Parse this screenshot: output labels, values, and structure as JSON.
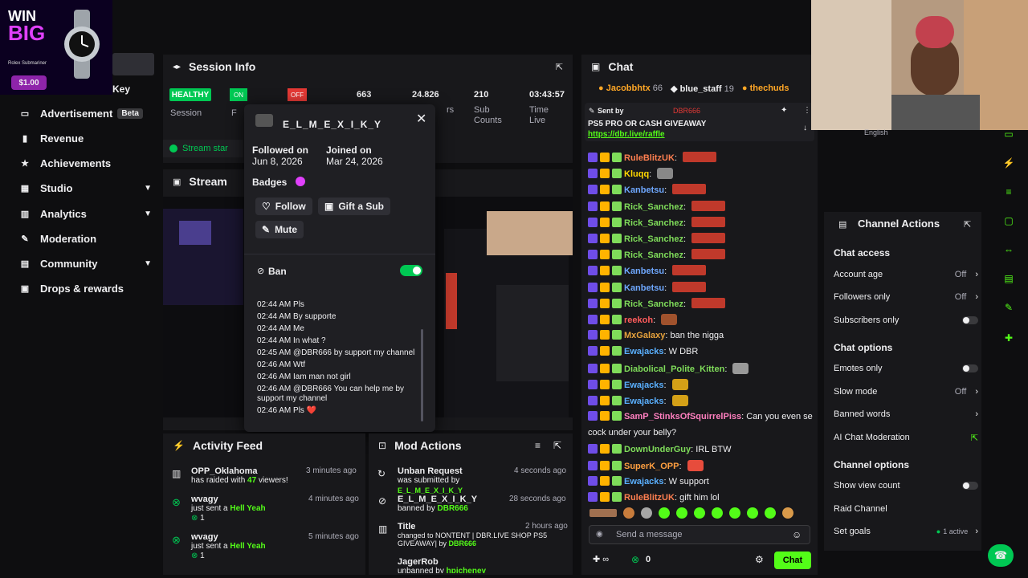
{
  "promo": {
    "line1": "WIN",
    "line2": "BIG",
    "small": "Rolex Submariner",
    "price": "$1.00"
  },
  "nav": {
    "key_label": "Key",
    "items": [
      {
        "label": "Advertisement",
        "badge": "Beta",
        "icon": "ad-icon"
      },
      {
        "label": "Revenue",
        "icon": "dollar-icon"
      },
      {
        "label": "Achievements",
        "icon": "star-icon"
      },
      {
        "label": "Studio",
        "icon": "studio-icon",
        "chevron": true
      },
      {
        "label": "Analytics",
        "icon": "chart-icon",
        "chevron": true
      },
      {
        "label": "Moderation",
        "icon": "wrench-icon"
      },
      {
        "label": "Community",
        "icon": "people-icon",
        "chevron": true
      },
      {
        "label": "Drops & rewards",
        "icon": "gift-icon"
      }
    ]
  },
  "session": {
    "title": "Session Info",
    "health_badge": "HEALTHY",
    "on_badge": "ON",
    "off_badge": "OFF",
    "label_session": "Session",
    "label_f": "F",
    "val_663": "663",
    "val_followers": "24.826",
    "label_followers_partial": "rs",
    "val_subs": "210",
    "label_subs": "Sub Counts",
    "val_time": "03:43:57",
    "label_time": "Time Live",
    "stream_status": "Stream star"
  },
  "stream": {
    "title": "Stream"
  },
  "popup": {
    "username": "E_L_M_E_X_I_K_Y",
    "followed_label": "Followed on",
    "followed_date": "Jun 8, 2026",
    "joined_label": "Joined on",
    "joined_date": "Mar 24, 2026",
    "badges_label": "Badges",
    "follow": "Follow",
    "gift": "Gift a Sub",
    "mute": "Mute",
    "ban": "Ban",
    "log": [
      "02:44 AM Pls",
      "02:44 AM By supporte",
      "02:44 AM Me",
      "02:44 AM In what ?",
      "02:45 AM @DBR666 by support my channel",
      "02:46 AM Wtf",
      "02:46 AM Iam man not girl",
      "02:46 AM @DBR666 You can help me by support my channel",
      "02:46 AM Pls ❤️"
    ]
  },
  "activity": {
    "title": "Activity Feed",
    "items": [
      {
        "name": "OPP_Oklahoma",
        "text1": "has raided with ",
        "bold": "47",
        "text2": " viewers!",
        "time": "3 minutes ago"
      },
      {
        "name": "wvagy",
        "text1": "just sent a ",
        "bold": "Hell Yeah",
        "text2": "",
        "count": "1",
        "time": "4 minutes ago"
      },
      {
        "name": "wvagy",
        "text1": "just sent a ",
        "bold": "Hell Yeah",
        "text2": "",
        "count": "1",
        "time": "5 minutes ago"
      }
    ]
  },
  "mod": {
    "title": "Mod Actions",
    "items": [
      {
        "name": "Unban Request",
        "text1": "was submitted by ",
        "bold": "E_L_M_E_X_I_K_Y",
        "time": "4 seconds ago"
      },
      {
        "name": "E_L_M_E_X_I_K_Y",
        "text1": "banned by ",
        "bold": "DBR666",
        "time": "28 seconds ago"
      },
      {
        "name": "Title",
        "text1": "changed to NONTENT | DBR.LIVE SHOP PS5 GIVEAWAY| by ",
        "bold": "DBR666",
        "time": "2 hours ago"
      },
      {
        "name": "JagerRob",
        "text1": "unbanned by ",
        "bold": "hpicheney",
        "time": "2 hours ago"
      }
    ]
  },
  "chat": {
    "title": "Chat",
    "top": [
      {
        "name": "Jacobbhtx",
        "count": "66"
      },
      {
        "name": "blue_staff",
        "count": "19"
      },
      {
        "name": "thechuds",
        "count": ""
      }
    ],
    "pinned_by": "Sent by",
    "pinned_name": "DBR666",
    "pinned_text": "PS5 PRO OR CASH GIVEAWAY",
    "pinned_link": "https://dbr.live/raffle",
    "messages": [
      {
        "name": "RuleBlitzUK",
        "color": "#ff7f50",
        "text": "",
        "redact": true
      },
      {
        "name": "Kluqq",
        "color": "#ffd700",
        "text": "",
        "emote": "#888888"
      },
      {
        "name": "Kanbetsu",
        "color": "#6fa8ff",
        "text": "",
        "redact": true
      },
      {
        "name": "Rick_Sanchez",
        "color": "#7fdc5a",
        "text": "",
        "redact": true
      },
      {
        "name": "Rick_Sanchez",
        "color": "#7fdc5a",
        "text": "",
        "redact": true
      },
      {
        "name": "Rick_Sanchez",
        "color": "#7fdc5a",
        "text": "",
        "redact": true
      },
      {
        "name": "Rick_Sanchez",
        "color": "#7fdc5a",
        "text": "",
        "redact": true
      },
      {
        "name": "Kanbetsu",
        "color": "#6fa8ff",
        "text": "",
        "redact": true
      },
      {
        "name": "Kanbetsu",
        "color": "#6fa8ff",
        "text": "",
        "redact": true
      },
      {
        "name": "Rick_Sanchez",
        "color": "#7fdc5a",
        "text": "",
        "redact": true
      },
      {
        "name": "reekoh",
        "color": "#ff5c5c",
        "text": "",
        "emote": "#a0522d"
      },
      {
        "name": "MxGalaxy",
        "color": "#e6a23c",
        "text": "ban the nigga"
      },
      {
        "name": "Ewajacks",
        "color": "#5ab0ff",
        "text": "W DBR"
      },
      {
        "name": "Diabolical_Polite_Kitten",
        "color": "#7fdc5a",
        "text": "",
        "emote": "#999999"
      },
      {
        "name": "Ewajacks",
        "color": "#5ab0ff",
        "text": "",
        "emote": "#d4a017"
      },
      {
        "name": "Ewajacks",
        "color": "#5ab0ff",
        "text": "",
        "emote": "#d4a017"
      },
      {
        "name": "SamP_StinksOfSquirrelPiss",
        "color": "#ff7fbf",
        "text": "Can you even see your"
      },
      {
        "name": "",
        "color": "#efeff1",
        "text": "cock under your belly?"
      },
      {
        "name": "DownUnderGuy",
        "color": "#7fdc5a",
        "text": "IRL BTW"
      },
      {
        "name": "SuperK_OPP",
        "color": "#ff9f40",
        "text": "",
        "emote": "#e74c3c"
      },
      {
        "name": "Ewajacks",
        "color": "#5ab0ff",
        "text": "W support"
      },
      {
        "name": "RuleBlitzUK",
        "color": "#ff7f50",
        "text": "gift him lol"
      }
    ],
    "input_placeholder": "Send a message",
    "count": "0",
    "send": "Chat"
  },
  "channel_actions": {
    "title": "Channel Actions",
    "chat_access": "Chat access",
    "account_age": "Account age",
    "account_age_val": "Off",
    "followers_only": "Followers only",
    "followers_only_val": "Off",
    "subscribers_only": "Subscribers only",
    "chat_options": "Chat options",
    "emotes_only": "Emotes only",
    "slow_mode": "Slow mode",
    "slow_mode_val": "Off",
    "banned_words": "Banned words",
    "ai_mod": "AI Chat Moderation",
    "channel_options": "Channel options",
    "show_view_count": "Show view count",
    "raid_channel": "Raid Channel",
    "set_goals": "Set goals",
    "set_goals_val": "1 active"
  },
  "webcam": {
    "language": "English"
  },
  "colors": {
    "accent": "#53fc18",
    "panel": "#18181b",
    "bg": "#0e0e10"
  }
}
